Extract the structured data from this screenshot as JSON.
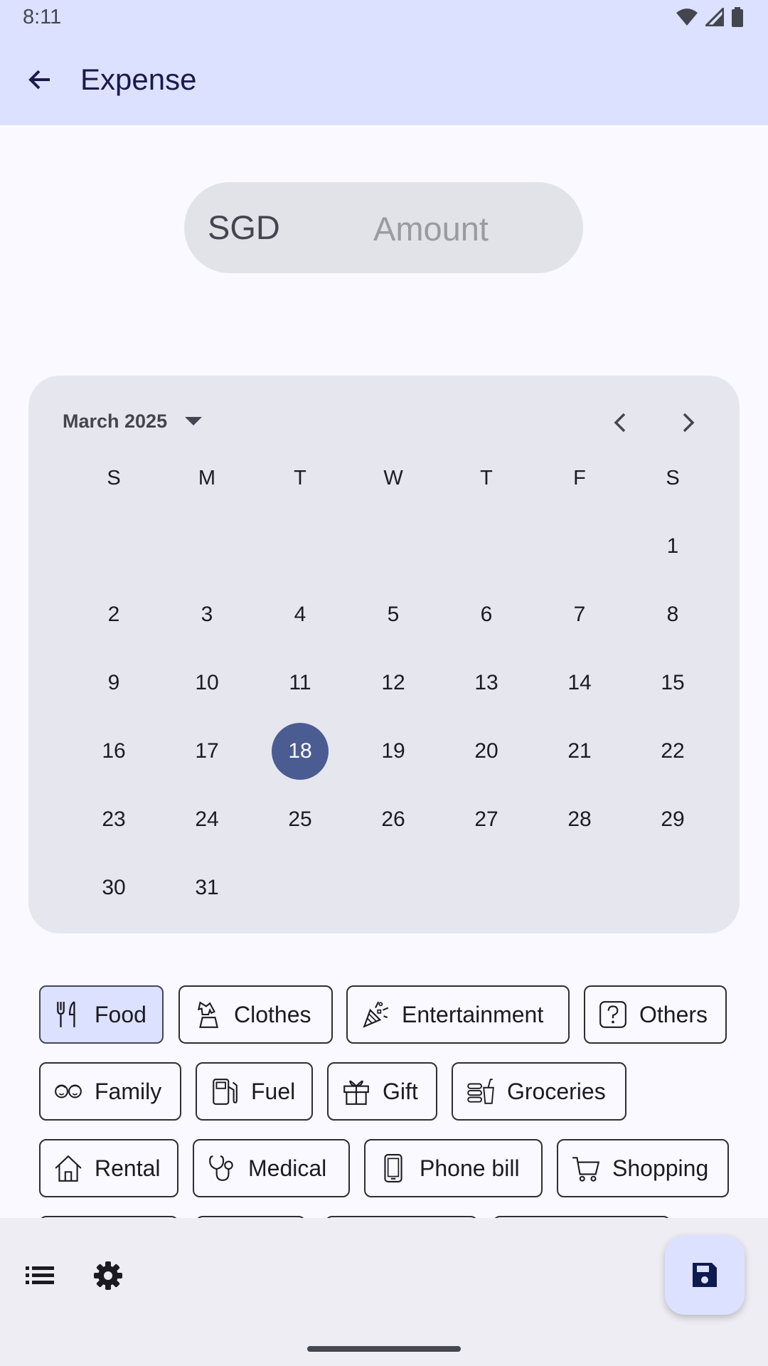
{
  "status_bar": {
    "time": "8:11"
  },
  "app_bar": {
    "title": "Expense"
  },
  "amount": {
    "currency": "SGD",
    "placeholder": "Amount",
    "value": ""
  },
  "calendar": {
    "month_label": "March 2025",
    "weekdays": [
      "S",
      "M",
      "T",
      "W",
      "T",
      "F",
      "S"
    ],
    "first_weekday_index": 6,
    "days_in_month": 31,
    "selected_day": 18
  },
  "categories": [
    {
      "label": "Food",
      "icon": "fork-knife-icon",
      "selected": true
    },
    {
      "label": "Clothes",
      "icon": "clothes-icon",
      "selected": false
    },
    {
      "label": "Entertainment",
      "icon": "party-popper-icon",
      "selected": false
    },
    {
      "label": "Others",
      "icon": "question-icon",
      "selected": false
    },
    {
      "label": "Family",
      "icon": "family-icon",
      "selected": false
    },
    {
      "label": "Fuel",
      "icon": "fuel-pump-icon",
      "selected": false
    },
    {
      "label": "Gift",
      "icon": "gift-icon",
      "selected": false
    },
    {
      "label": "Groceries",
      "icon": "groceries-icon",
      "selected": false
    },
    {
      "label": "Rental",
      "icon": "house-icon",
      "selected": false
    },
    {
      "label": "Medical",
      "icon": "stethoscope-icon",
      "selected": false
    },
    {
      "label": "Phone bill",
      "icon": "phone-icon",
      "selected": false
    },
    {
      "label": "Shopping",
      "icon": "cart-icon",
      "selected": false
    }
  ],
  "bottom_bar": {
    "list_icon": "list-icon",
    "settings_icon": "gear-icon",
    "fab_icon": "save-icon"
  }
}
